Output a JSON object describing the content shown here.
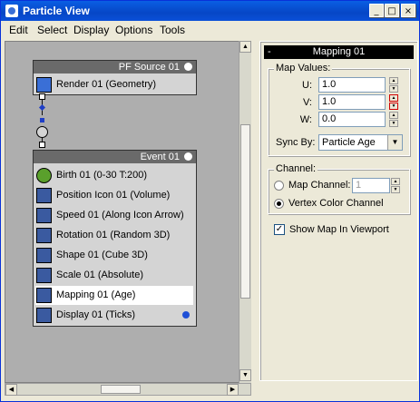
{
  "window": {
    "title": "Particle View",
    "min": "_",
    "max": "□",
    "close": "×"
  },
  "menu": [
    "Edit",
    "Select",
    "Display",
    "Options",
    "Tools"
  ],
  "source_node": {
    "title": "PF Source 01",
    "operator": "Render 01 (Geometry)"
  },
  "event_node": {
    "title": "Event 01",
    "operators": [
      {
        "label": "Birth 01 (0-30 T:200)",
        "icon": "birth-icon",
        "color": "#5aa02c"
      },
      {
        "label": "Position Icon 01 (Volume)",
        "icon": "position-icon-icon",
        "color": "#3a5aa0"
      },
      {
        "label": "Speed 01 (Along Icon Arrow)",
        "icon": "speed-icon",
        "color": "#3a5aa0"
      },
      {
        "label": "Rotation 01 (Random 3D)",
        "icon": "rotation-icon",
        "color": "#3a5aa0"
      },
      {
        "label": "Shape 01 (Cube 3D)",
        "icon": "shape-icon",
        "color": "#3a5aa0"
      },
      {
        "label": "Scale 01 (Absolute)",
        "icon": "scale-icon",
        "color": "#3a5aa0"
      },
      {
        "label": "Mapping 01 (Age)",
        "icon": "mapping-icon",
        "color": "#3a5aa0"
      },
      {
        "label": "Display 01 (Ticks)",
        "icon": "display-icon",
        "color": "#3a5aa0"
      }
    ],
    "selected_index": 6
  },
  "panel": {
    "rollout_title": "Mapping 01",
    "collapse": "-",
    "map_values": {
      "group_label": "Map Values:",
      "u_label": "U:",
      "u_value": "1.0",
      "v_label": "V:",
      "v_value": "1.0",
      "w_label": "W:",
      "w_value": "0.0",
      "sync_label": "Sync By:",
      "sync_value": "Particle Age"
    },
    "channel": {
      "group_label": "Channel:",
      "map_channel_label": "Map Channel:",
      "map_channel_value": "1",
      "vertex_color_label": "Vertex Color Channel",
      "selected": "vertex_color"
    },
    "show_map_label": "Show Map In Viewport",
    "show_map_checked": true
  },
  "colors": {
    "title_bar": "#0a5fe3",
    "accent_dot": "#1f4fd6",
    "node_header": "#6a6a6a"
  }
}
